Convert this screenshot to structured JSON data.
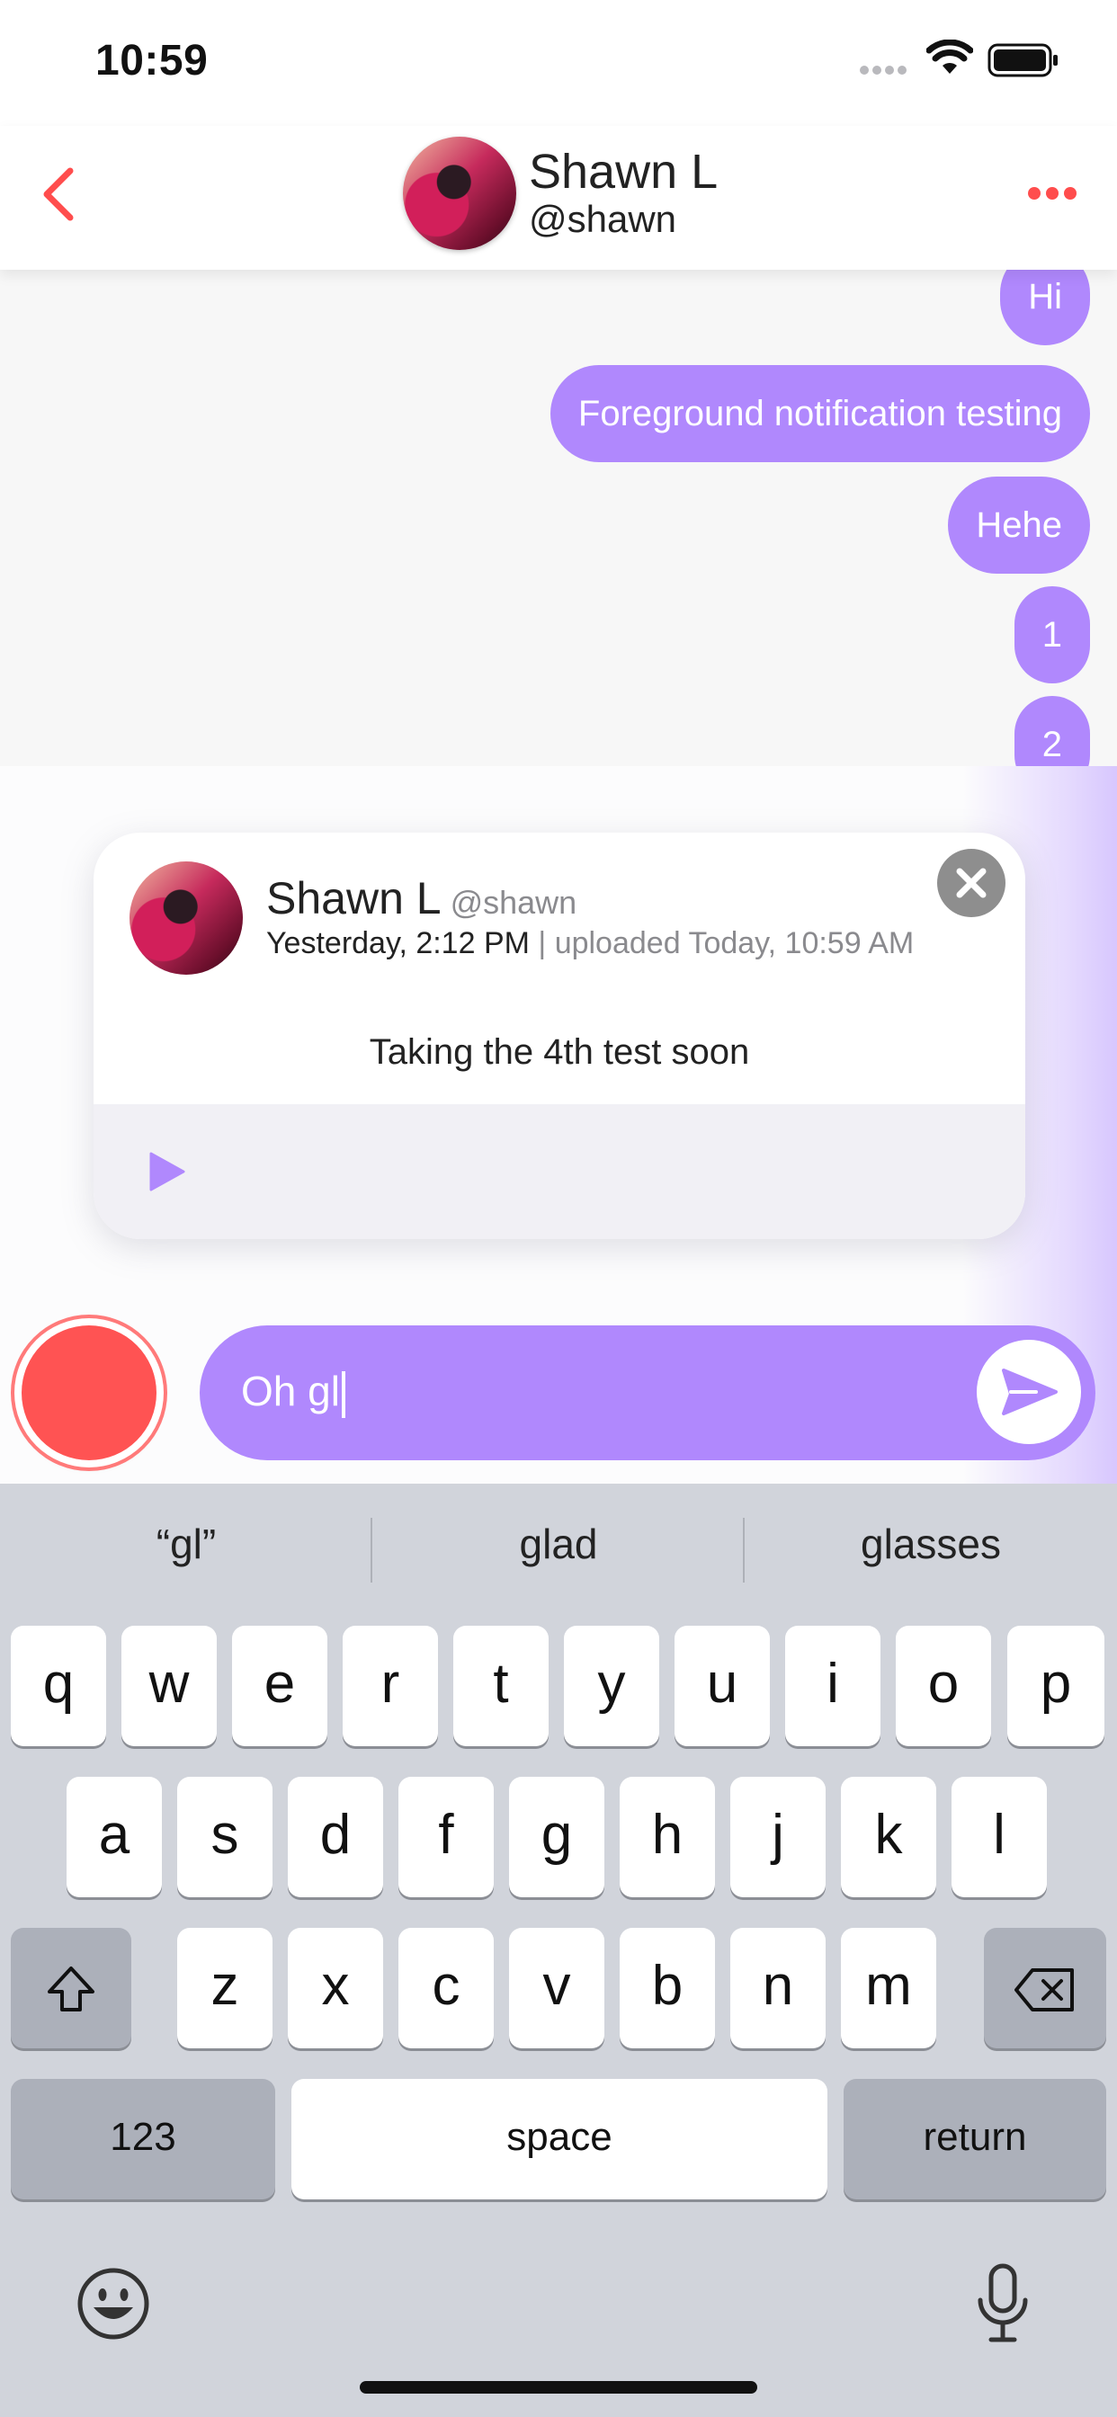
{
  "status_bar": {
    "time": "10:59"
  },
  "header": {
    "name": "Shawn L",
    "handle": "@shawn"
  },
  "messages": [
    {
      "text": "Hi"
    },
    {
      "text": "Foreground notification testing"
    },
    {
      "text": "Hehe"
    },
    {
      "text": "1"
    },
    {
      "text": "2"
    }
  ],
  "notification_card": {
    "name": "Shawn L",
    "handle": "@shawn",
    "recorded": "Yesterday, 2:12 PM",
    "separator": " | ",
    "uploaded": "uploaded Today, 10:59 AM",
    "message": "Taking the 4th test soon"
  },
  "composer": {
    "input_value": "Oh gl"
  },
  "keyboard": {
    "suggestions": [
      "“gl”",
      "glad",
      "glasses"
    ],
    "row1": [
      "q",
      "w",
      "e",
      "r",
      "t",
      "y",
      "u",
      "i",
      "o",
      "p"
    ],
    "row2": [
      "a",
      "s",
      "d",
      "f",
      "g",
      "h",
      "j",
      "k",
      "l"
    ],
    "row3": [
      "z",
      "x",
      "c",
      "v",
      "b",
      "n",
      "m"
    ],
    "numbers_label": "123",
    "space_label": "space",
    "return_label": "return"
  },
  "colors": {
    "accent_purple": "#b088fd",
    "record_red": "#ff5353",
    "back_red": "#ff4d4d"
  },
  "icons": [
    "signal-icon",
    "wifi-icon",
    "battery-icon",
    "back-chevron-icon",
    "more-dots-icon",
    "close-icon",
    "play-icon",
    "send-icon",
    "shift-icon",
    "delete-icon",
    "emoji-icon",
    "microphone-icon"
  ]
}
